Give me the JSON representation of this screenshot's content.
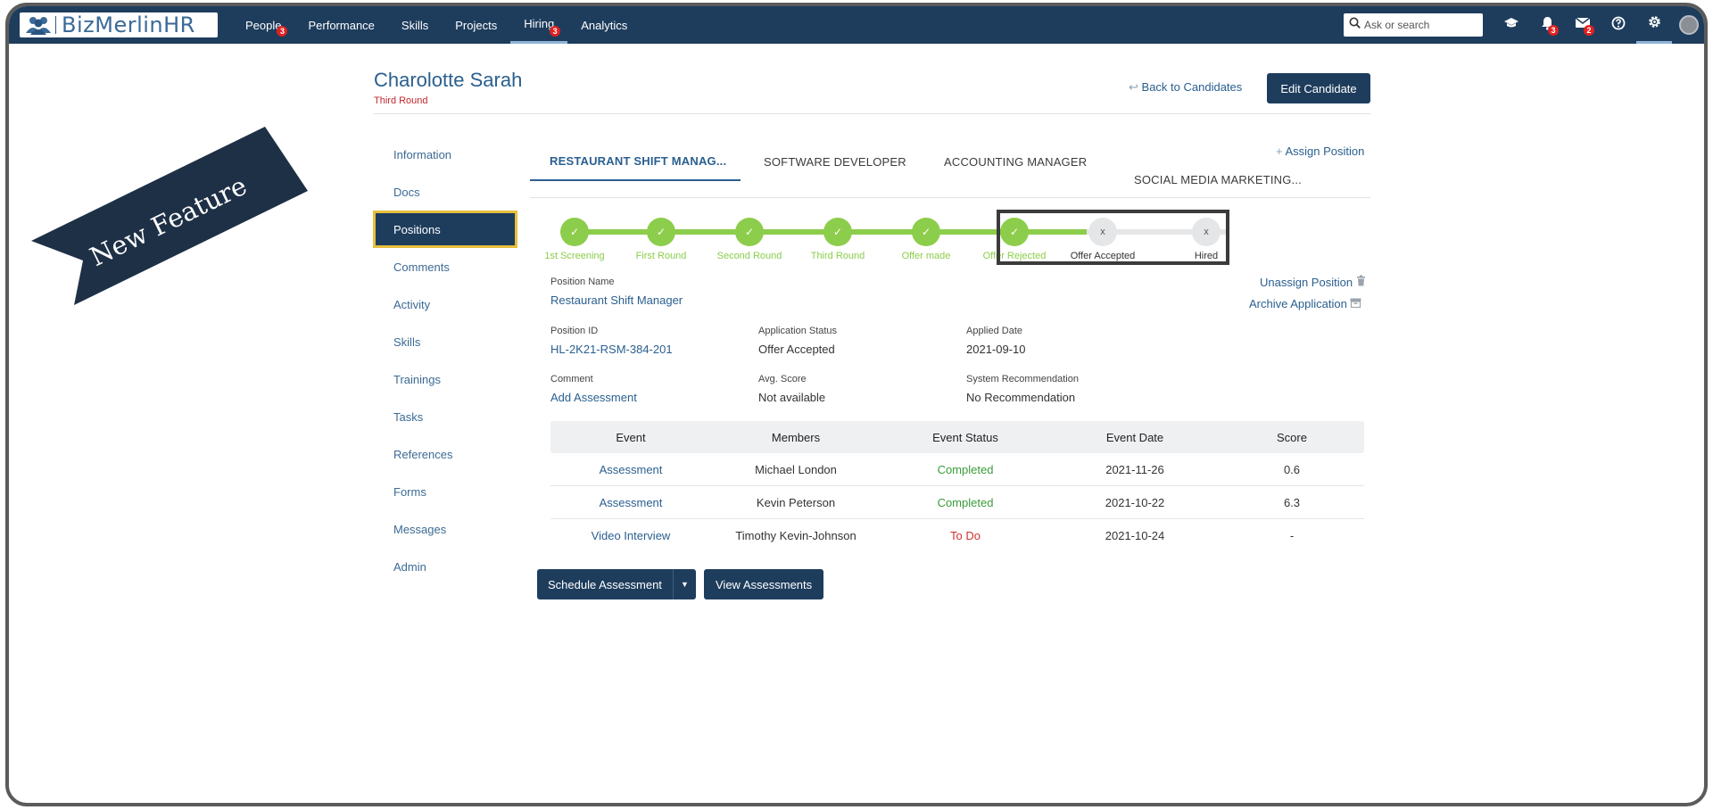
{
  "app": {
    "logo_text": "BizMerlinHR",
    "accent": "#1e3d5d",
    "link_color": "#2a5f8f",
    "success_color": "#8ccd4b"
  },
  "nav": {
    "items": [
      {
        "label": "People",
        "badge": "3"
      },
      {
        "label": "Performance",
        "badge": ""
      },
      {
        "label": "Skills",
        "badge": ""
      },
      {
        "label": "Projects",
        "badge": ""
      },
      {
        "label": "Hiring",
        "badge": "3"
      },
      {
        "label": "Analytics",
        "badge": ""
      }
    ],
    "search_placeholder": "Ask or search",
    "notifications_badge": "3",
    "messages_badge": "2"
  },
  "ribbon_text": "New Feature",
  "candidate": {
    "name": "Charolotte Sarah",
    "stage": "Third Round",
    "back_label": "Back to Candidates",
    "edit_label": "Edit Candidate"
  },
  "side_menu": [
    "Information",
    "Docs",
    "Positions",
    "Comments",
    "Activity",
    "Skills",
    "Trainings",
    "Tasks",
    "References",
    "Forms",
    "Messages",
    "Admin"
  ],
  "tabs": [
    "RESTAURANT SHIFT MANAG...",
    "SOFTWARE DEVELOPER",
    "ACCOUNTING MANAGER",
    "SOCIAL MEDIA MARKETING..."
  ],
  "assign_position": "Assign Position",
  "pipeline": [
    {
      "label": "1st Screening",
      "done": true
    },
    {
      "label": "First Round",
      "done": true
    },
    {
      "label": "Second Round",
      "done": true
    },
    {
      "label": "Third Round",
      "done": true
    },
    {
      "label": "Offer made",
      "done": true
    },
    {
      "label": "Offer Rejected",
      "done": true
    },
    {
      "label": "Offer Accepted",
      "done": false
    },
    {
      "label": "Hired",
      "done": false
    }
  ],
  "details": {
    "position_name_label": "Position Name",
    "position_name": "Restaurant Shift Manager",
    "unassign_label": "Unassign Position",
    "archive_label": "Archive Application",
    "position_id_label": "Position ID",
    "position_id": "HL-2K21-RSM-384-201",
    "app_status_label": "Application Status",
    "app_status": "Offer Accepted",
    "applied_date_label": "Applied Date",
    "applied_date": "2021-09-10",
    "comment_label": "Comment",
    "comment_link": "Add Assessment",
    "avg_score_label": "Avg. Score",
    "avg_score": "Not available",
    "sys_rec_label": "System Recommendation",
    "sys_rec": "No Recommendation"
  },
  "events": {
    "headers": [
      "Event",
      "Members",
      "Event Status",
      "Event Date",
      "Score"
    ],
    "rows": [
      {
        "event": "Assessment",
        "member": "Michael London",
        "status": "Completed",
        "status_type": "completed",
        "date": "2021-11-26",
        "score": "0.6"
      },
      {
        "event": "Assessment",
        "member": "Kevin Peterson",
        "status": "Completed",
        "status_type": "completed",
        "date": "2021-10-22",
        "score": "6.3"
      },
      {
        "event": "Video Interview",
        "member": "Timothy Kevin-Johnson",
        "status": "To Do",
        "status_type": "todo",
        "date": "2021-10-24",
        "score": "-"
      }
    ]
  },
  "actions": {
    "schedule_label": "Schedule Assessment",
    "view_label": "View Assessments"
  }
}
